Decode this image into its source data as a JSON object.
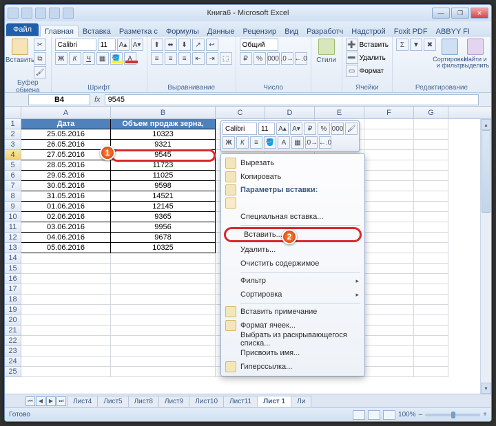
{
  "title": "Книга6 - Microsoft Excel",
  "qat_count": 5,
  "window_controls": {
    "min": "—",
    "max": "❐",
    "close": "✕"
  },
  "ribbon": {
    "file": "Файл",
    "tabs": [
      "Главная",
      "Вставка",
      "Разметка с",
      "Формулы",
      "Данные",
      "Рецензир",
      "Вид",
      "Разработч",
      "Надстрой",
      "Foxit PDF",
      "ABBYY FI"
    ],
    "active_tab": 0,
    "groups": {
      "clipboard": {
        "label": "Буфер обмена",
        "paste": "Вставить"
      },
      "font": {
        "label": "Шрифт",
        "name": "Calibri",
        "size": "11",
        "bold": "Ж",
        "italic": "К",
        "underline": "Ч"
      },
      "alignment": {
        "label": "Выравнивание"
      },
      "number": {
        "label": "Число",
        "format": "Общий"
      },
      "styles": {
        "label": "Стили",
        "btn": "Стили"
      },
      "cells": {
        "label": "Ячейки",
        "insert": "Вставить",
        "delete": "Удалить",
        "format": "Формат"
      },
      "editing": {
        "label": "Редактирование",
        "sort": "Сортировка и фильтр",
        "find": "Найти и выделить"
      }
    }
  },
  "namebox": "B4",
  "formula": "9545",
  "columns": [
    "A",
    "B",
    "C",
    "D",
    "E",
    "F",
    "G"
  ],
  "col_keys": [
    "A",
    "B",
    "C",
    "D",
    "E",
    "F",
    "G"
  ],
  "header_row": {
    "A": "Дата",
    "B": "Объем продаж зерна,"
  },
  "data_rows": [
    {
      "A": "25.05.2016",
      "B": "10323"
    },
    {
      "A": "26.05.2016",
      "B": "9321"
    },
    {
      "A": "27.05.2016",
      "B": "9545"
    },
    {
      "A": "28.05.2016",
      "B": "11723"
    },
    {
      "A": "29.05.2016",
      "B": "11025"
    },
    {
      "A": "30.05.2016",
      "B": "9598"
    },
    {
      "A": "31.05.2016",
      "B": "14521"
    },
    {
      "A": "01.06.2016",
      "B": "12145"
    },
    {
      "A": "02.06.2016",
      "B": "9365"
    },
    {
      "A": "03.06.2016",
      "B": "9956"
    },
    {
      "A": "04.06.2016",
      "B": "9678"
    },
    {
      "A": "05.06.2016",
      "B": "10325"
    }
  ],
  "empty_rows_to": 25,
  "selected_row_index": 4,
  "mini_toolbar": {
    "font": "Calibri",
    "size": "11"
  },
  "context_menu": {
    "cut": "Вырезать",
    "copy": "Копировать",
    "paste_opts_header": "Параметры вставки:",
    "paste_special": "Специальная вставка...",
    "insert": "Вставить...",
    "delete": "Удалить...",
    "clear": "Очистить содержимое",
    "filter": "Фильтр",
    "sort": "Сортировка",
    "comment": "Вставить примечание",
    "format": "Формат ячеек...",
    "dropdown": "Выбрать из раскрывающегося списка...",
    "name": "Присвоить имя...",
    "hyperlink": "Гиперссылка..."
  },
  "callouts": {
    "1": "1",
    "2": "2"
  },
  "sheet_tabs": {
    "list": [
      "Лист4",
      "Лист5",
      "Лист8",
      "Лист9",
      "Лист10",
      "Лист11",
      "Лист 1",
      "Ли"
    ],
    "active": 6
  },
  "status": {
    "ready": "Готово",
    "zoom": "100%",
    "minus": "–",
    "plus": "+"
  }
}
